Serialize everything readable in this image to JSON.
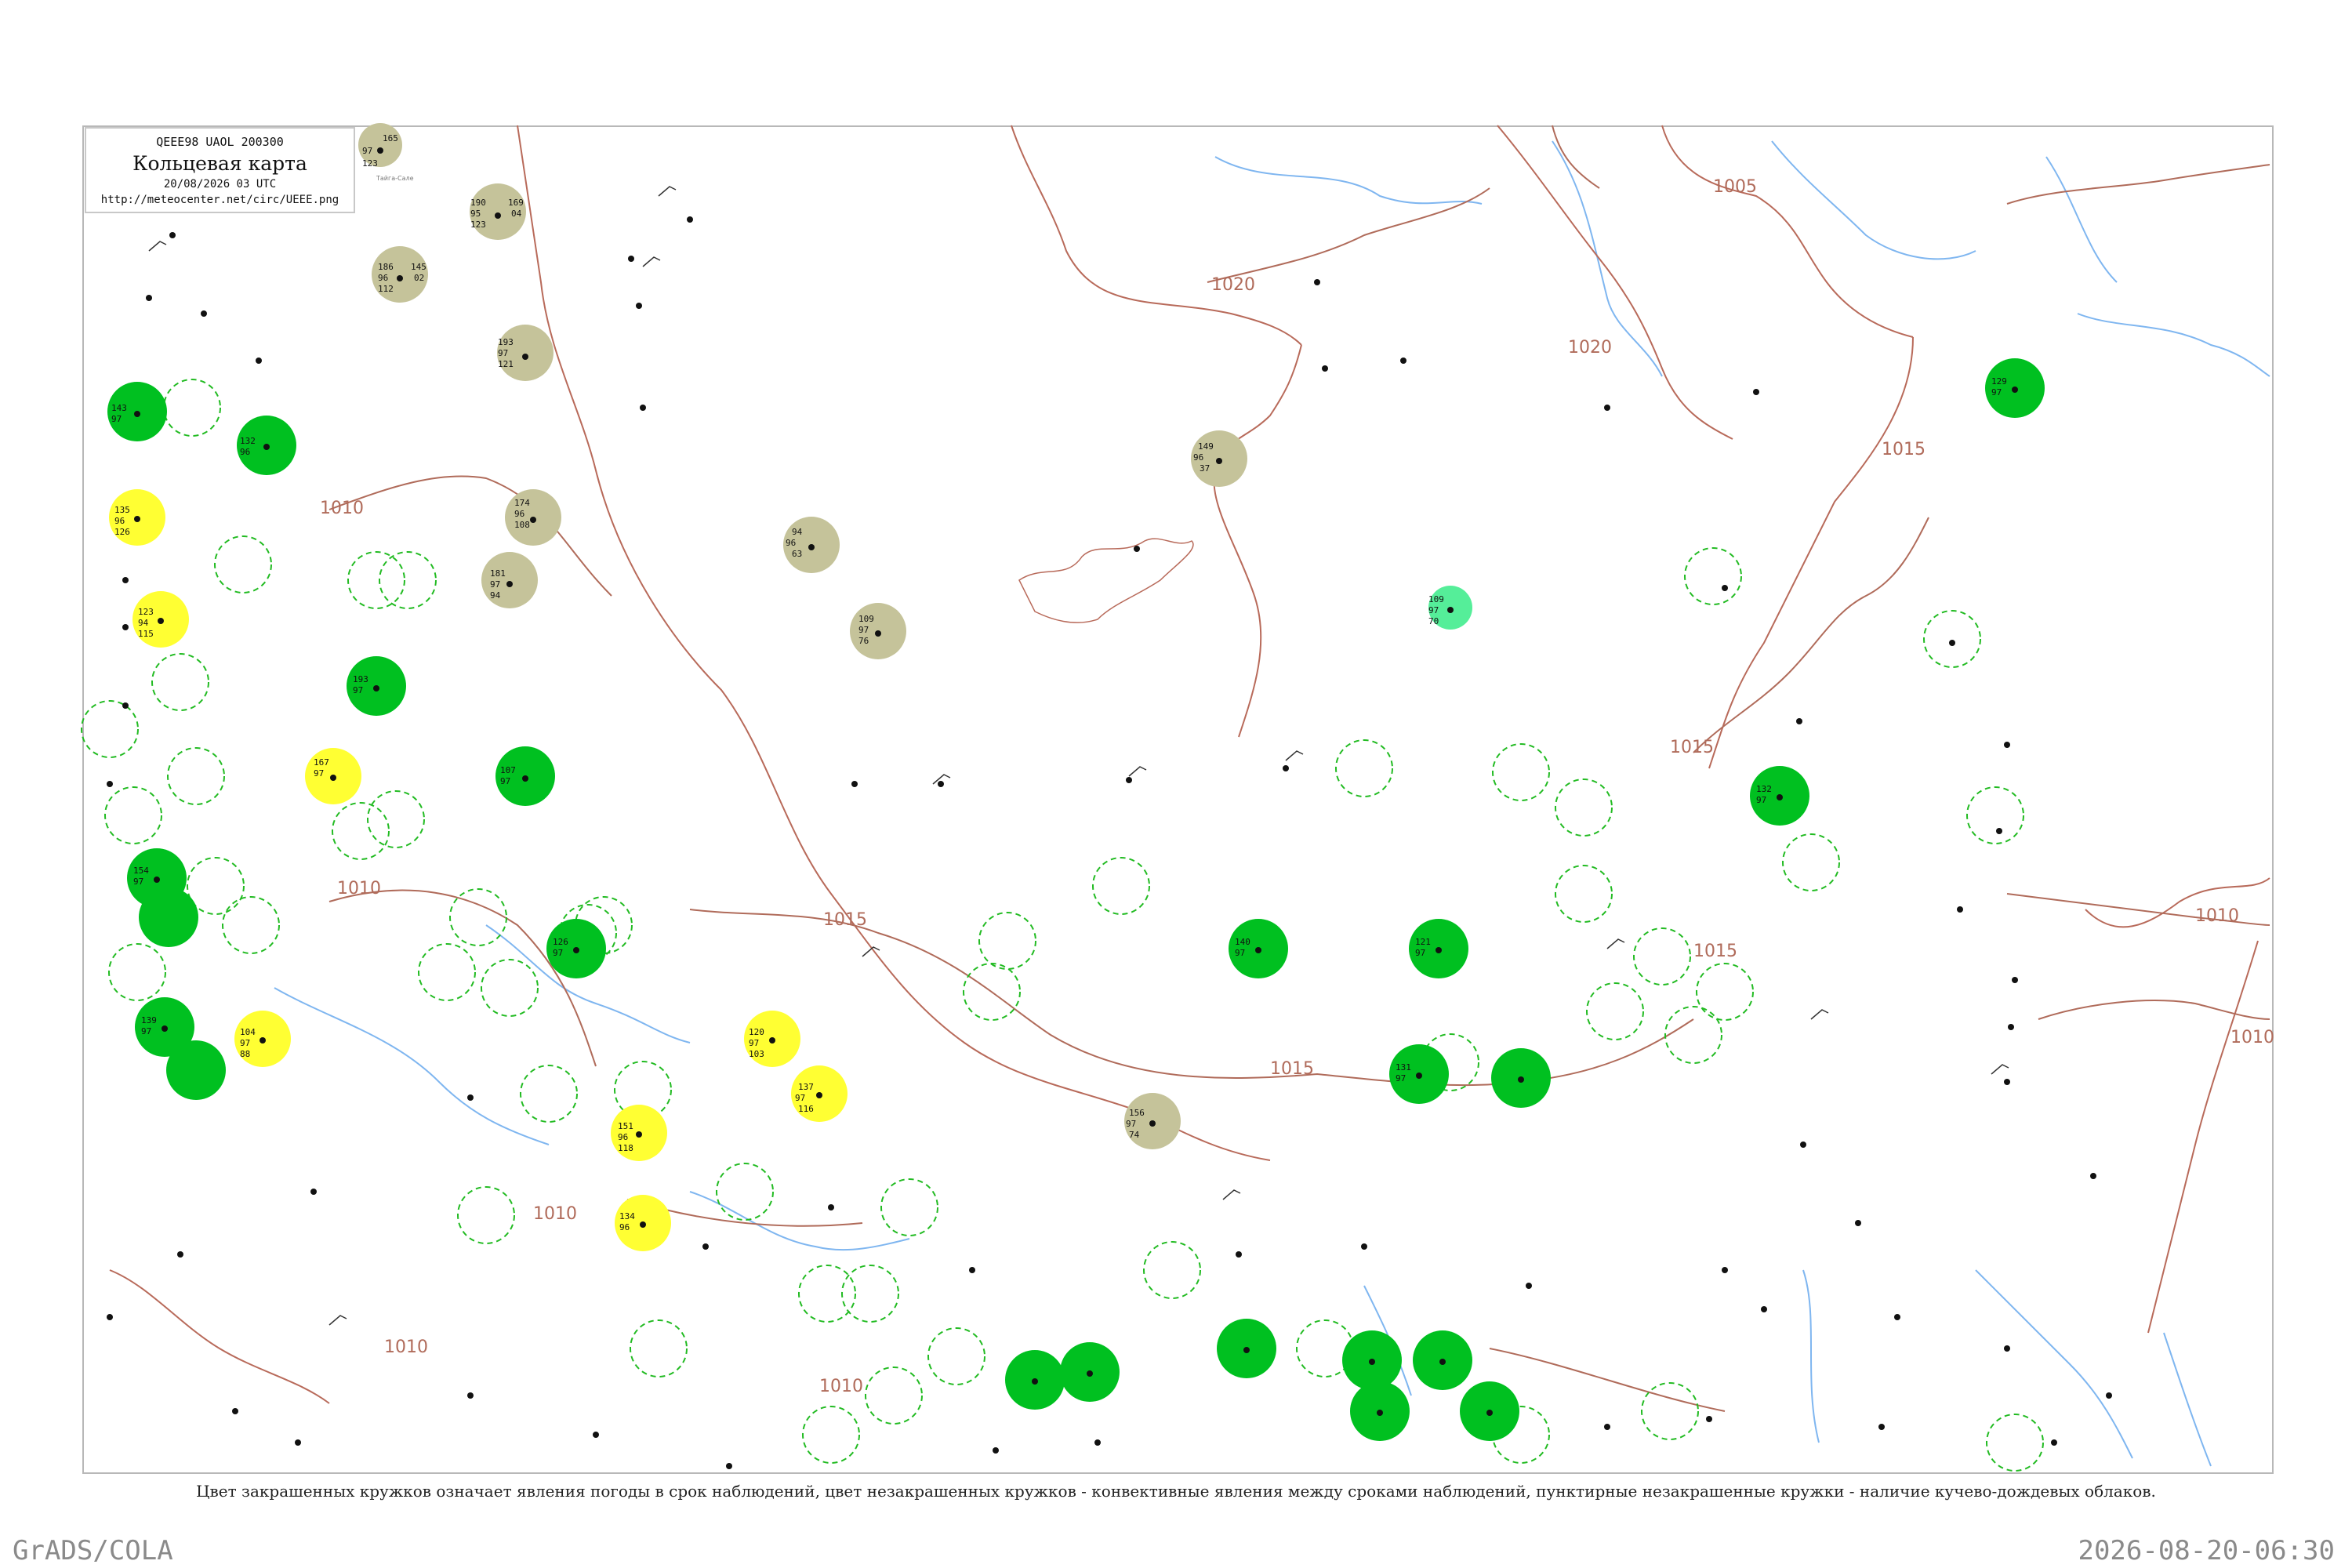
{
  "header": {
    "code": "QEEE98  UAOL  200300",
    "title": "Кольцевая карта",
    "datetime": "20/08/2026 03 UTC",
    "url": "http://meteocenter.net/circ/UEEE.png"
  },
  "caption": "Цвет закрашенных кружков означает явления погоды в срок наблюдений, цвет незакрашенных кружков - конвективные явления между сроками наблюдений, пунктирные незакрашенные кружки - наличие кучево-дождевых облаков.",
  "footer": {
    "software": "GrADS/COLA",
    "timestamp": "2026-08-20-06:30"
  },
  "colors": {
    "frame": "#b8b8b8",
    "isobar": "#b06b5a",
    "river": "#7fb6f0",
    "fill_green": "#00c020",
    "fill_olive": "#c5c39a",
    "fill_yellow": "#ffff33",
    "fill_mint": "#55ee99",
    "ring_green": "#22bb22"
  },
  "isobar_labels": [
    "1005",
    "1010",
    "1015",
    "1020"
  ],
  "stations": [
    {
      "pressure": "165",
      "temp": "97",
      "dew": "123",
      "name": "Тайга-Сале",
      "kind": "olive"
    },
    {
      "pressure": "190",
      "temp": "95",
      "dew": "123",
      "name": "",
      "kind": "olive"
    },
    {
      "pressure": "169",
      "temp": "04",
      "dew": "",
      "name": "",
      "kind": "olive"
    },
    {
      "pressure": "186",
      "temp": "96",
      "dew": "112",
      "name": "",
      "kind": "olive"
    },
    {
      "pressure": "145",
      "temp": "02",
      "dew": "",
      "name": "",
      "kind": "olive"
    },
    {
      "pressure": "193",
      "temp": "97",
      "dew": "121",
      "name": "",
      "kind": "olive"
    },
    {
      "pressure": "174",
      "temp": "96",
      "dew": "108",
      "name": "",
      "kind": "olive"
    },
    {
      "pressure": "181",
      "temp": "97",
      "dew": "94",
      "name": "",
      "kind": "olive"
    },
    {
      "pressure": "94",
      "temp": "96",
      "dew": "63",
      "name": "",
      "kind": "olive"
    },
    {
      "pressure": "109",
      "temp": "97",
      "dew": "76",
      "name": "",
      "kind": "olive"
    },
    {
      "pressure": "149",
      "temp": "96",
      "dew": "37",
      "name": "",
      "kind": "olive"
    },
    {
      "pressure": "156",
      "temp": "97",
      "dew": "74",
      "name": "",
      "kind": "olive"
    },
    {
      "pressure": "143",
      "temp": "97",
      "dew": "",
      "name": "",
      "kind": "green"
    },
    {
      "pressure": "132",
      "temp": "96",
      "dew": "",
      "name": "",
      "kind": "green"
    },
    {
      "pressure": "193",
      "temp": "97",
      "dew": "",
      "name": "",
      "kind": "green"
    },
    {
      "pressure": "107",
      "temp": "97",
      "dew": "",
      "name": "",
      "kind": "green"
    },
    {
      "pressure": "154",
      "temp": "97",
      "dew": "",
      "name": "",
      "kind": "green"
    },
    {
      "pressure": "139",
      "temp": "97",
      "dew": "",
      "name": "",
      "kind": "green"
    },
    {
      "pressure": "126",
      "temp": "97",
      "dew": "",
      "name": "",
      "kind": "green"
    },
    {
      "pressure": "140",
      "temp": "97",
      "dew": "",
      "name": "",
      "kind": "green"
    },
    {
      "pressure": "121",
      "temp": "97",
      "dew": "",
      "name": "",
      "kind": "green"
    },
    {
      "pressure": "131",
      "temp": "97",
      "dew": "",
      "name": "",
      "kind": "green"
    },
    {
      "pressure": "132",
      "temp": "97",
      "dew": "",
      "name": "",
      "kind": "green"
    },
    {
      "pressure": "129",
      "temp": "97",
      "dew": "",
      "name": "",
      "kind": "green"
    },
    {
      "pressure": "109",
      "temp": "97",
      "dew": "70",
      "name": "",
      "kind": "mint"
    },
    {
      "pressure": "135",
      "temp": "96",
      "dew": "126",
      "name": "",
      "kind": "yellow"
    },
    {
      "pressure": "123",
      "temp": "94",
      "dew": "115",
      "name": "",
      "kind": "yellow"
    },
    {
      "pressure": "167",
      "temp": "97",
      "dew": "",
      "name": "",
      "kind": "yellow"
    },
    {
      "pressure": "104",
      "temp": "97",
      "dew": "88",
      "name": "",
      "kind": "yellow"
    },
    {
      "pressure": "120",
      "temp": "97",
      "dew": "103",
      "name": "",
      "kind": "yellow"
    },
    {
      "pressure": "137",
      "temp": "97",
      "dew": "116",
      "name": "",
      "kind": "yellow"
    },
    {
      "pressure": "151",
      "temp": "96",
      "dew": "118",
      "name": "",
      "kind": "yellow"
    },
    {
      "pressure": "134",
      "temp": "96",
      "dew": "",
      "name": "",
      "kind": "yellow"
    }
  ]
}
